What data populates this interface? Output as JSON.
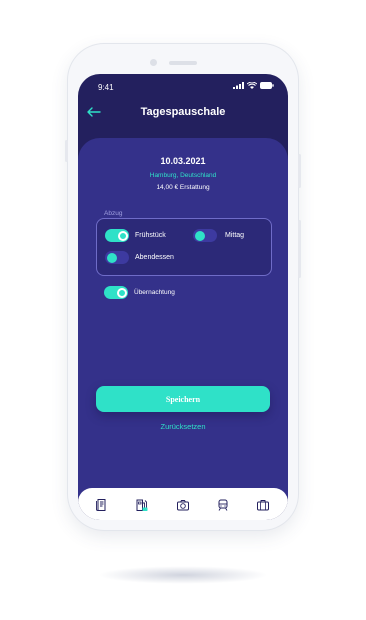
{
  "status_bar": {
    "time": "9:41"
  },
  "header": {
    "title": "Tagespauschale",
    "back_icon": "arrow-left-icon"
  },
  "summary": {
    "date": "10.03.2021",
    "location": "Hamburg, Deutschland",
    "refund": "14,00 € Erstattung"
  },
  "abzug": {
    "label": "Abzug",
    "options": [
      {
        "label": "Frühstück",
        "enabled": true
      },
      {
        "label": "Mittag",
        "enabled": false
      },
      {
        "label": "Abendessen",
        "enabled": false
      }
    ]
  },
  "overnight": {
    "label": "Übernachtung",
    "enabled": true
  },
  "actions": {
    "save_label": "Speichern",
    "reset_label": "Zurücksetzen"
  },
  "tabbar": {
    "items": [
      "receipt-icon",
      "fuel-pump-icon",
      "camera-icon",
      "train-icon",
      "suitcase-icon"
    ]
  },
  "colors": {
    "accent": "#2fe1c8",
    "background": "#23205e",
    "card": "#34318a",
    "tabbar": "#ffffff"
  }
}
